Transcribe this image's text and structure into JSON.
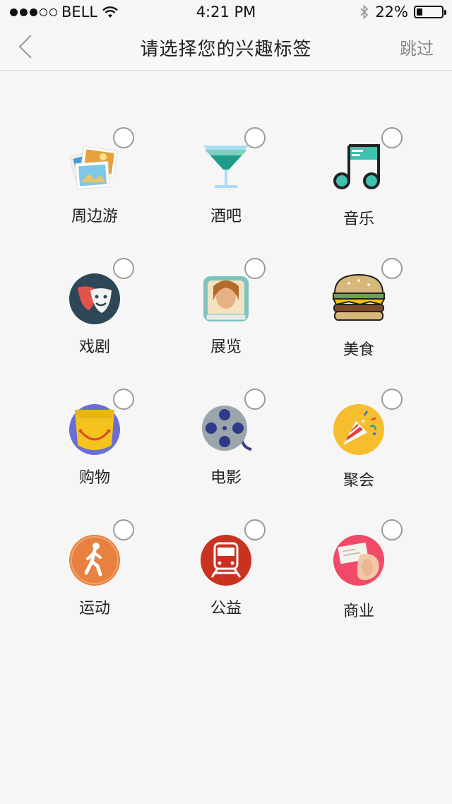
{
  "status_bar": {
    "carrier": "BELL",
    "time": "4:21 PM",
    "battery": "22%"
  },
  "nav": {
    "title": "请选择您的兴趣标签",
    "skip_label": "跳过"
  },
  "tags": [
    {
      "label": "周边游",
      "icon": "photos-icon"
    },
    {
      "label": "酒吧",
      "icon": "cocktail-icon"
    },
    {
      "label": "音乐",
      "icon": "music-note-icon"
    },
    {
      "label": "戏剧",
      "icon": "theater-masks-icon"
    },
    {
      "label": "展览",
      "icon": "exhibition-portrait-icon"
    },
    {
      "label": "美食",
      "icon": "burger-icon"
    },
    {
      "label": "购物",
      "icon": "shopping-bag-icon"
    },
    {
      "label": "电影",
      "icon": "film-reel-icon"
    },
    {
      "label": "聚会",
      "icon": "party-popper-icon"
    },
    {
      "label": "运动",
      "icon": "walking-person-icon"
    },
    {
      "label": "公益",
      "icon": "train-icon"
    },
    {
      "label": "商业",
      "icon": "business-card-icon"
    }
  ]
}
